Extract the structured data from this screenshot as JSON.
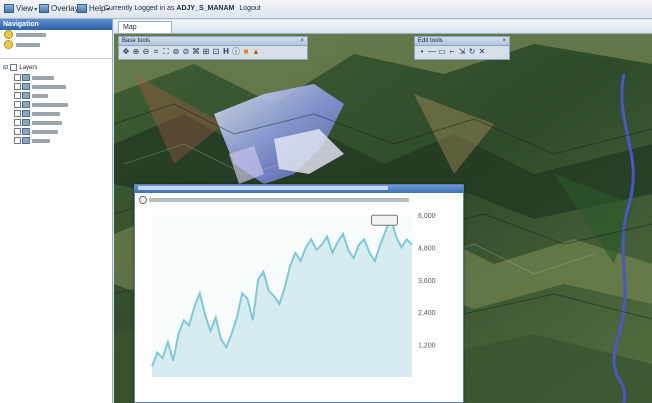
{
  "menubar": {
    "items": [
      {
        "label": "View",
        "icon": "view-icon"
      },
      {
        "label": "Overlay",
        "icon": "overlay-icon"
      },
      {
        "label": "Help",
        "icon": "help-icon"
      }
    ],
    "login_prefix": "Currently Logged in as",
    "user": "ADJY_S_MANAM",
    "logout": "Logout"
  },
  "navigation": {
    "title": "Navigation",
    "rows": [
      "",
      ""
    ],
    "layers_root": "Layers",
    "layers": [
      "",
      "",
      "",
      "",
      "",
      "",
      "",
      ""
    ]
  },
  "map": {
    "tab": "Map",
    "base_tools_title": "Base tools",
    "edit_tools_title": "Edit tools"
  },
  "profile_window": {
    "title": "",
    "subtitle": ""
  },
  "chart_data": {
    "type": "area",
    "title": "",
    "xlabel": "",
    "ylabel": "",
    "ylim": [
      0,
      6000
    ],
    "yticks": [
      "1,200",
      "2,400",
      "3,600",
      "4,800",
      "6,000"
    ],
    "series": [
      {
        "color": "#7fc9d6",
        "values": [
          400,
          900,
          700,
          1300,
          600,
          1600,
          2100,
          1900,
          2600,
          3100,
          2300,
          1700,
          2200,
          1400,
          1100,
          1600,
          2200,
          3100,
          2900,
          2100,
          3600,
          3900,
          3200,
          3000,
          2700,
          3300,
          4100,
          4600,
          4300,
          4800,
          5100,
          4700,
          4900,
          5200,
          4600,
          5000,
          5300,
          4700,
          4400,
          4900,
          5100,
          4600,
          4300,
          4900,
          5400,
          5900,
          5200,
          4800,
          5100,
          4900
        ]
      }
    ],
    "tooltip": ""
  }
}
